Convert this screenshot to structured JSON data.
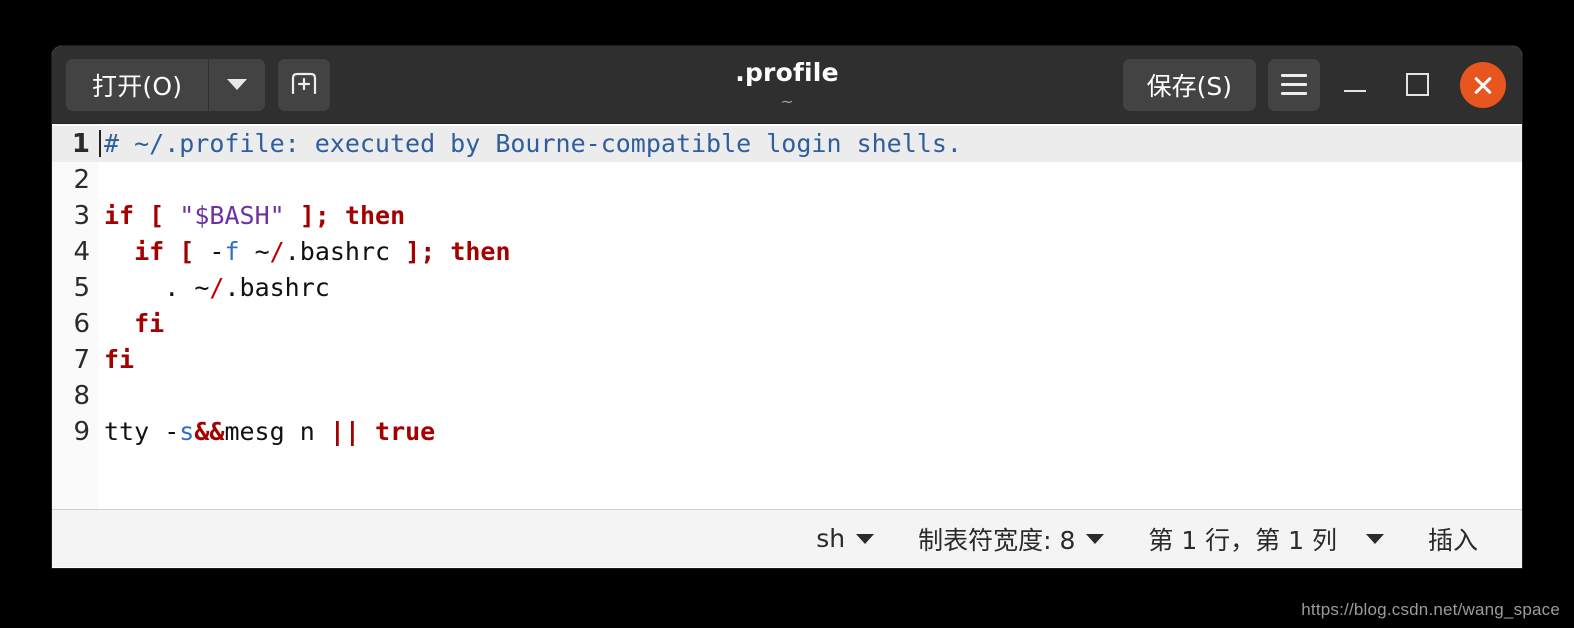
{
  "window": {
    "title": ".profile",
    "subtitle": "~"
  },
  "toolbar": {
    "open_label": "打开(O)",
    "open_dropdown_icon": "chevron-down-icon",
    "new_document_icon": "new-tab-plus-icon",
    "save_label": "保存(S)",
    "menu_icon": "hamburger-menu-icon",
    "minimize_icon": "minimize-icon",
    "maximize_icon": "maximize-icon",
    "close_icon": "close-icon",
    "close_color": "#e8561f"
  },
  "editor": {
    "current_line": 1,
    "line_numbers": [
      "1",
      "2",
      "3",
      "4",
      "5",
      "6",
      "7",
      "8",
      "9"
    ],
    "lines": [
      "# ~/.profile: executed by Bourne-compatible login shells.",
      "",
      "if [ \"$BASH\" ]; then",
      "  if [ -f ~/.bashrc ]; then",
      "    . ~/.bashrc",
      "  fi",
      "fi",
      "",
      "tty -s&&mesg n || true"
    ]
  },
  "statusbar": {
    "language": "sh",
    "tab_width_label": "制表符宽度: 8",
    "position_label": "第 1 行，第 1 列",
    "insert_mode": "插入"
  },
  "watermark": {
    "text": "https://blog.csdn.net/wang_space"
  }
}
